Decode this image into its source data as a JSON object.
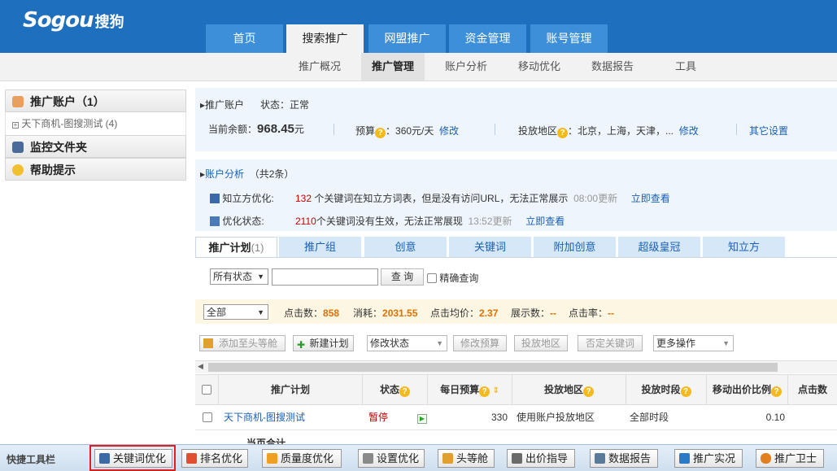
{
  "brand": {
    "logo_text": "Sogou",
    "logo_cn": "搜狗"
  },
  "main_tabs": [
    {
      "label": "首页"
    },
    {
      "label": "搜索推广"
    },
    {
      "label": "网盟推广"
    },
    {
      "label": "资金管理"
    },
    {
      "label": "账号管理"
    }
  ],
  "sub_tabs": [
    {
      "label": "推广概况"
    },
    {
      "label": "推广管理"
    },
    {
      "label": "账户分析"
    },
    {
      "label": "移动优化"
    },
    {
      "label": "数据报告"
    },
    {
      "label": "工具"
    }
  ],
  "sidebar": {
    "account_title": "推广账户（1）",
    "account_item": "天下商机-图搜测试 (4)",
    "monitor_title": "监控文件夹",
    "help_title": "帮助提示"
  },
  "info": {
    "account_label": "推广账户",
    "status_label": "状态：",
    "status_value": "正常",
    "balance_label": "当前余额：",
    "balance_value": "968.45",
    "balance_unit": "元",
    "budget_label": "预算",
    "budget_value": "：360元/天",
    "budget_edit": "修改",
    "region_label": "投放地区",
    "region_value": "：北京，上海，天津，...",
    "region_edit": "修改",
    "other_settings": "其它设置"
  },
  "analysis": {
    "title": "账户分析",
    "count": "（共2条）",
    "row1_label": "知立方优化:",
    "row1_num": "132",
    "row1_text": "个关键词在知立方词表，但是没有访问URL，无法正常展示",
    "row1_time": "08:00更新",
    "row1_link": "立即查看",
    "row2_label": "优化状态:",
    "row2_num": "2110",
    "row2_text": "个关键词没有生效，无法正常展现",
    "row2_time": "13:52更新",
    "row2_link": "立即查看"
  },
  "content_tabs": [
    {
      "label": "推广计划",
      "count": "(1)"
    },
    {
      "label": "推广组"
    },
    {
      "label": "创意"
    },
    {
      "label": "关键词"
    },
    {
      "label": "附加创意"
    },
    {
      "label": "超级皇冠"
    },
    {
      "label": "知立方"
    }
  ],
  "filter": {
    "status_select": "所有状态",
    "search_button": "查 询",
    "exact_label": "精确查询"
  },
  "stats": {
    "range_select": "全部",
    "clicks_label": "点击数：",
    "clicks_value": "858",
    "cost_label": "消耗：",
    "cost_value": "2031.55",
    "avg_label": "点击均价：",
    "avg_value": "2.37",
    "impr_label": "展示数：",
    "impr_value": "--",
    "ctr_label": "点击率：",
    "ctr_value": "--"
  },
  "toolbar": {
    "add_head": "添加至头等舱",
    "new_plan": "新建计划",
    "modify_status": "修改状态",
    "modify_budget": "修改预算",
    "region": "投放地区",
    "negative_kw": "否定关键词",
    "more_ops": "更多操作"
  },
  "table": {
    "headers": [
      "推广计划",
      "状态",
      "每日预算",
      "投放地区",
      "投放时段",
      "移动出价比例",
      "点击数"
    ],
    "row": {
      "plan": "天下商机-图搜测试",
      "status": "暂停",
      "budget": "330",
      "region": "使用账户投放地区",
      "period": "全部时段",
      "mobile_ratio": "0.10"
    },
    "total_label": "当页合计"
  },
  "quickbar": {
    "title": "快捷工具栏",
    "buttons": [
      "关键词优化",
      "排名优化",
      "质量度优化",
      "设置优化",
      "头等舱",
      "出价指导",
      "数据报告",
      "推广实况",
      "推广卫士"
    ]
  }
}
